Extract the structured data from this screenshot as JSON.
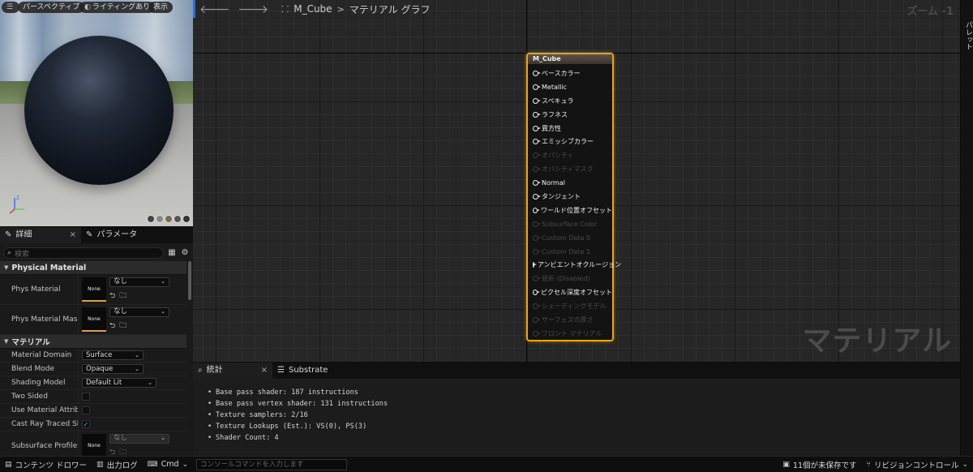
{
  "viewport": {
    "menu_icon": "hamburger-icon",
    "chips": [
      "パースペクティブ",
      "ライティングあり",
      "表示"
    ]
  },
  "details": {
    "tabs": [
      {
        "label": "詳細",
        "icon": "pencil-icon",
        "close": "×"
      },
      {
        "label": "パラメータ",
        "icon": "pencil-icon"
      }
    ],
    "search_placeholder": "検索",
    "sections": {
      "physical": "Physical Material",
      "material": "マテリアル"
    },
    "phys_material": {
      "label": "Phys Material",
      "thumb": "None",
      "value": "なし"
    },
    "phys_material_mask": {
      "label": "Phys Material Mask",
      "thumb": "None",
      "value": "なし"
    },
    "material_domain": {
      "label": "Material Domain",
      "value": "Surface"
    },
    "blend_mode": {
      "label": "Blend Mode",
      "value": "Opaque"
    },
    "shading_model": {
      "label": "Shading Model",
      "value": "Default Lit"
    },
    "two_sided": {
      "label": "Two Sided",
      "checked": false
    },
    "use_material_attributes": {
      "label": "Use Material Attributes",
      "checked": false
    },
    "cast_ray_traced": {
      "label": "Cast Ray Traced Shad..",
      "checked": true,
      "mark": "✓"
    },
    "subsurface_profile": {
      "label": "Subsurface Profile",
      "thumb": "None",
      "value": "なし"
    }
  },
  "graph": {
    "breadcrumb": {
      "asset": "M_Cube",
      "separator": ">",
      "page": "マテリアル グラフ"
    },
    "zoom_label": "ズーム -1",
    "watermark": "マテリアル",
    "node": {
      "title": "M_Cube",
      "pins": [
        {
          "label": "ベースカラー",
          "enabled": true
        },
        {
          "label": "Metallic",
          "enabled": true
        },
        {
          "label": "スペキュラ",
          "enabled": true
        },
        {
          "label": "ラフネス",
          "enabled": true
        },
        {
          "label": "異方性",
          "enabled": true
        },
        {
          "label": "エミッシブカラー",
          "enabled": true
        },
        {
          "label": "オパシティ",
          "enabled": false
        },
        {
          "label": "オパシティマスク",
          "enabled": false
        },
        {
          "label": "Normal",
          "enabled": true
        },
        {
          "label": "タンジェント",
          "enabled": true
        },
        {
          "label": "ワールド位置オフセット",
          "enabled": true
        },
        {
          "label": "Subsurface Color",
          "enabled": false
        },
        {
          "label": "Custom Data 0",
          "enabled": false
        },
        {
          "label": "Custom Data 1",
          "enabled": false
        },
        {
          "label": "アンビエントオクルージョン",
          "enabled": true
        },
        {
          "label": "屈折 (Disabled)",
          "enabled": false
        },
        {
          "label": "ピクセル深度オフセット",
          "enabled": true
        },
        {
          "label": "シェーディングモデル",
          "enabled": false
        },
        {
          "label": "サーフェスの厚さ",
          "enabled": false
        },
        {
          "label": "フロント マテリアル",
          "enabled": false
        }
      ]
    }
  },
  "palette": {
    "label": "パレット"
  },
  "stats": {
    "tabs": [
      {
        "label": "統計",
        "icon": "stats-icon",
        "close": "×"
      },
      {
        "label": "Substrate",
        "icon": "list-icon"
      }
    ],
    "lines": [
      "Base pass shader: 187 instructions",
      "Base pass vertex shader: 131 instructions",
      "Texture samplers: 2/16",
      "Texture Lookups (Est.): VS(0), PS(3)",
      "Shader Count: 4"
    ]
  },
  "statusbar": {
    "content_drawer": "コンテンツ ドロワー",
    "output_log": "出力ログ",
    "cmd": "Cmd",
    "cmd_placeholder": "コンソールコマンドを入力します",
    "unsaved": "11個が未保存です",
    "revision_control": "リビジョンコントロール"
  }
}
